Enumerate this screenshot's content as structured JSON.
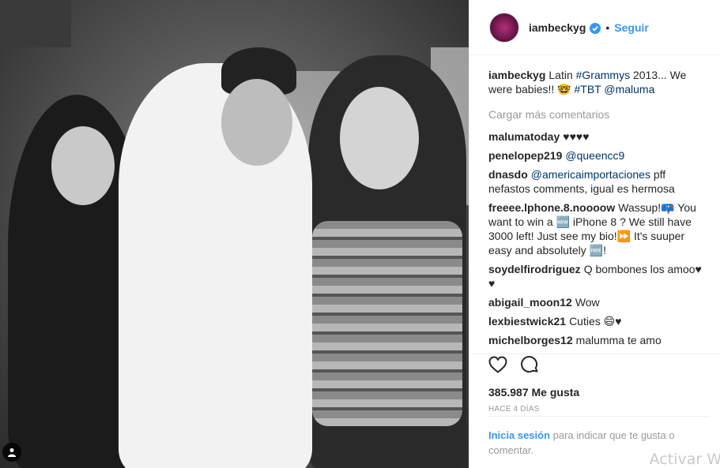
{
  "post": {
    "username": "iambeckyg",
    "follow_label": "Seguir",
    "separator": "•"
  },
  "caption": {
    "username": "iambeckyg",
    "text_before": "Latin ",
    "hashtag1": "#Grammys",
    "text_middle": " 2013... We were babies!! 🤓 ",
    "hashtag2": "#TBT",
    "mention": "@maluma"
  },
  "load_more": "Cargar más comentarios",
  "comments": [
    {
      "user": "malumatoday",
      "text": "♥♥♥♥"
    },
    {
      "user": "penelopep219",
      "text": "",
      "mention": "@queencc9"
    },
    {
      "user": "dnasdo",
      "mention": "@americaimportaciones",
      "text": " pff nefastos comments, igual es hermosa"
    },
    {
      "user": "freeee.lphone.8.noooow",
      "text": "Wassup!📪 You want to win a 🆕 iPhone 8 ? We still have 3000 left! Just see my bio!⏩ It's suuper easy and absolutely 🆓!"
    },
    {
      "user": "soydelfirodriguez",
      "text": "Q bombones los amoo♥ ♥"
    },
    {
      "user": "abigail_moon12",
      "text": "Wow"
    },
    {
      "user": "lexbiestwick21",
      "text": "Cuties 😄♥"
    },
    {
      "user": "michelborges12",
      "text": "malumma te amo"
    }
  ],
  "likes": "385.987 Me gusta",
  "time": "HACE 4 DÍAS",
  "login": {
    "link": "Inicia sesión",
    "text": " para indicar que te gusta o comentar."
  },
  "watermark": "Activar W",
  "icons": {
    "verified": "verified-badge-icon",
    "like": "heart-icon",
    "comment": "comment-bubble-icon",
    "tag": "person-tag-icon"
  },
  "colors": {
    "link": "#3897f0",
    "text": "#262626",
    "muted": "#999999",
    "mention": "#003569"
  }
}
